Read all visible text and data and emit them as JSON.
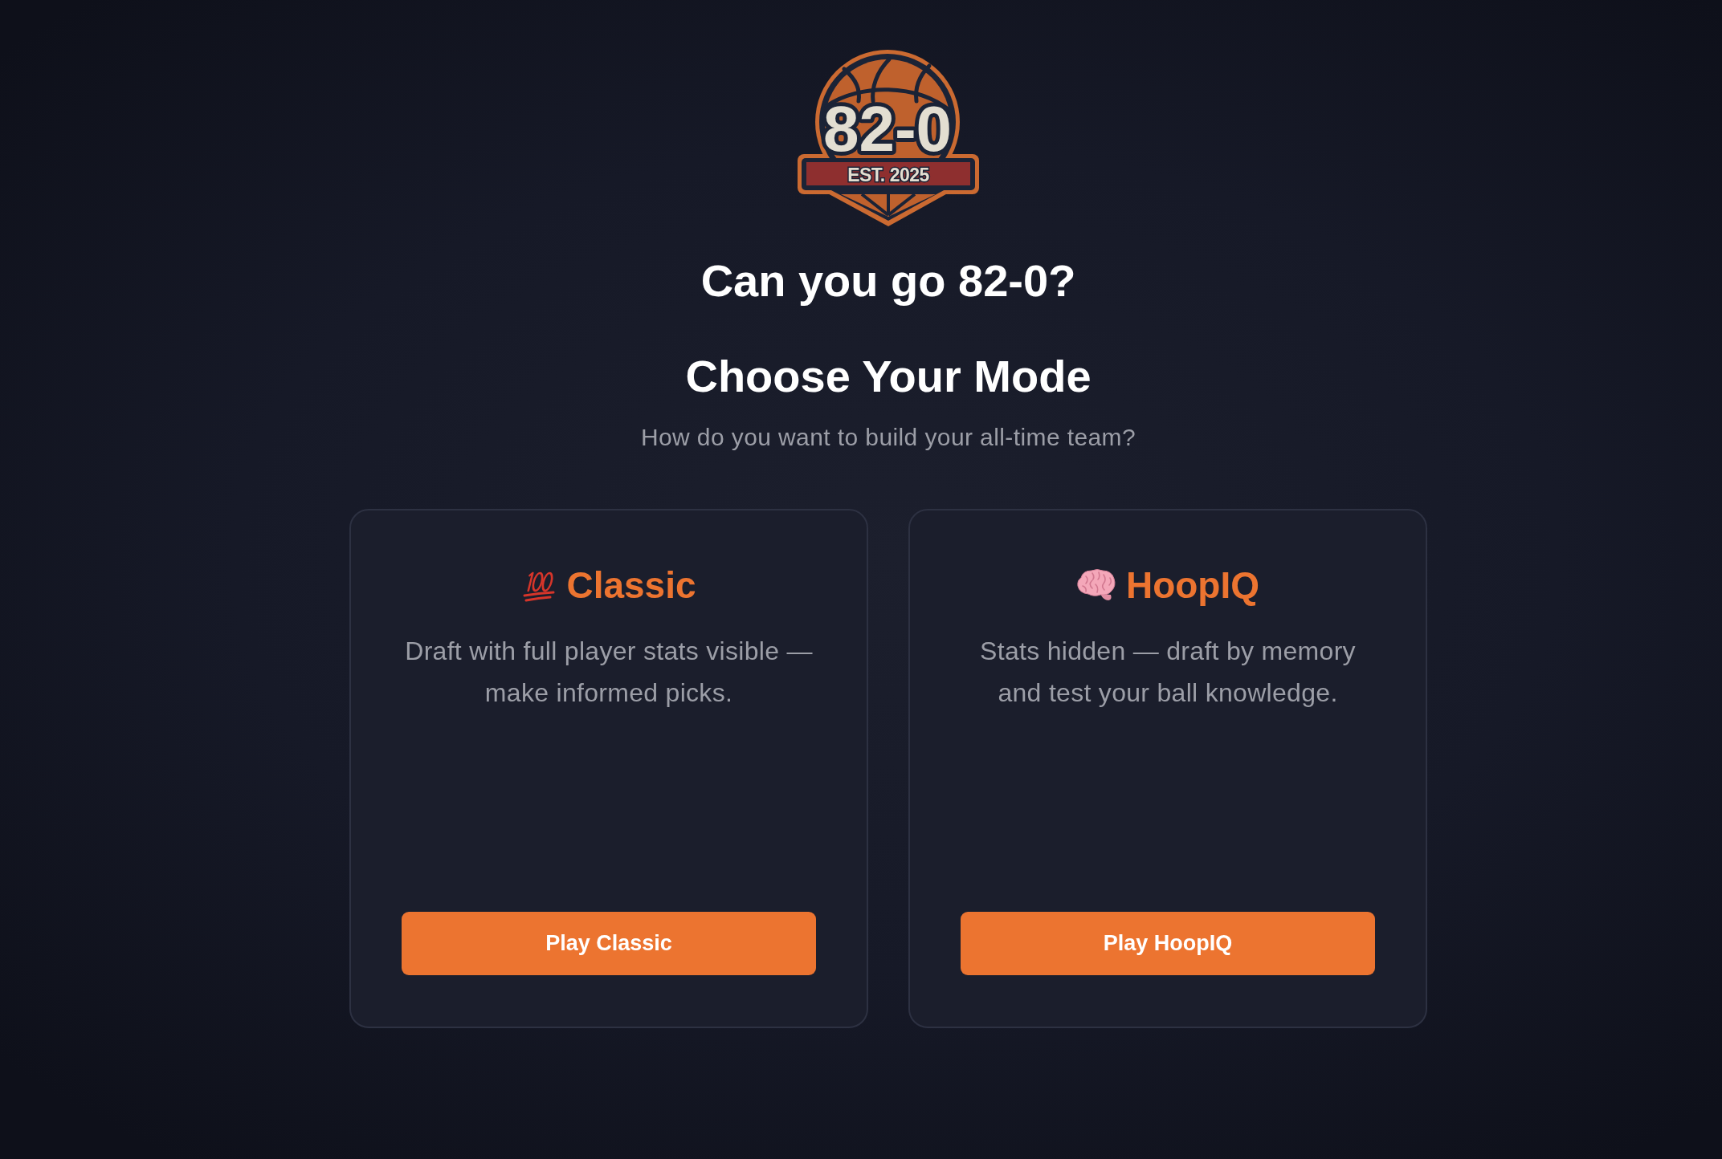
{
  "logo": {
    "wordmark": "82-0",
    "tagline": "EST. 2025"
  },
  "headline": "Can you go 82-0?",
  "heading": "Choose Your Mode",
  "subtitle": "How do you want to build your all-time team?",
  "modes": [
    {
      "kind": "classic",
      "title": "Classic",
      "description": "Draft with full player stats visible — make informed picks.",
      "button": "Play Classic"
    },
    {
      "kind": "quiz",
      "title": "HoopIQ",
      "description": "Stats hidden — draft by memory and test your ball knowledge.",
      "button": "Play HoopIQ"
    }
  ]
}
